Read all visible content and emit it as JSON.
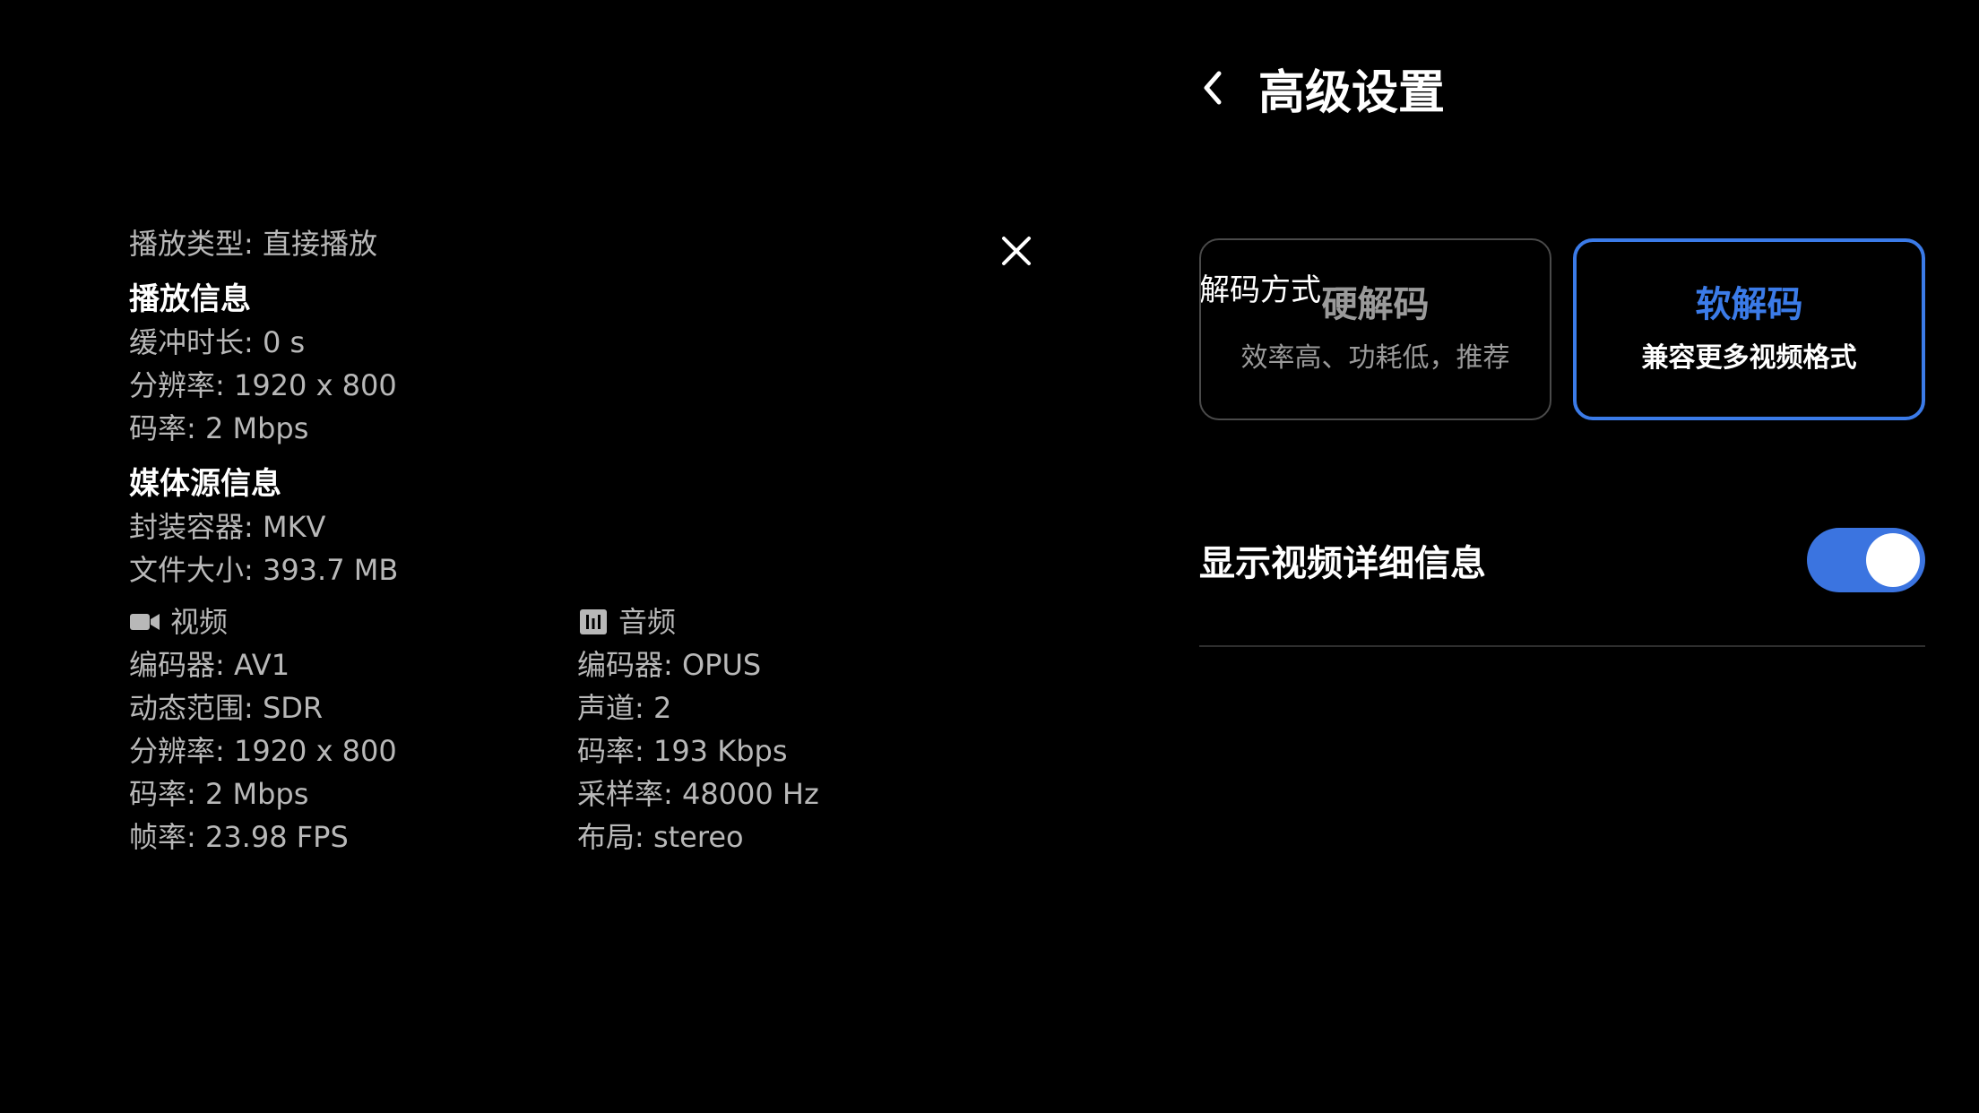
{
  "overlay": {
    "play_type": "播放类型: 直接播放",
    "playback_heading": "播放信息",
    "playback": {
      "buffer": "缓冲时长: 0 s",
      "resolution": "分辨率: 1920 x 800",
      "bitrate": "码率: 2 Mbps"
    },
    "source_heading": "媒体源信息",
    "source": {
      "container": "封装容器: MKV",
      "file_size": "文件大小: 393.7 MB"
    },
    "video": {
      "icon": "video-camera-icon",
      "label": "视频",
      "codec": "编码器: AV1",
      "dynamic_range": "动态范围: SDR",
      "resolution": "分辨率: 1920 x 800",
      "bitrate": "码率: 2 Mbps",
      "frame_rate": "帧率: 23.98 FPS"
    },
    "audio": {
      "icon": "audio-waveform-icon",
      "label": "音频",
      "codec": "编码器: OPUS",
      "channels": "声道:  2",
      "bitrate": "码率: 193 Kbps",
      "sample_rate": "采样率: 48000 Hz",
      "layout": "布局: stereo"
    },
    "close_icon": "close-icon"
  },
  "settings": {
    "title": "高级设置",
    "back_icon": "chevron-left-icon",
    "decode_label": "解码方式",
    "options": [
      {
        "title": "硬解码",
        "subtitle": "效率高、功耗低，推荐",
        "selected": false
      },
      {
        "title": "软解码",
        "subtitle": "兼容更多视频格式",
        "selected": true
      }
    ],
    "show_details_label": "显示视频详细信息",
    "show_details_on": true,
    "accent_color": "#3b7be8"
  }
}
